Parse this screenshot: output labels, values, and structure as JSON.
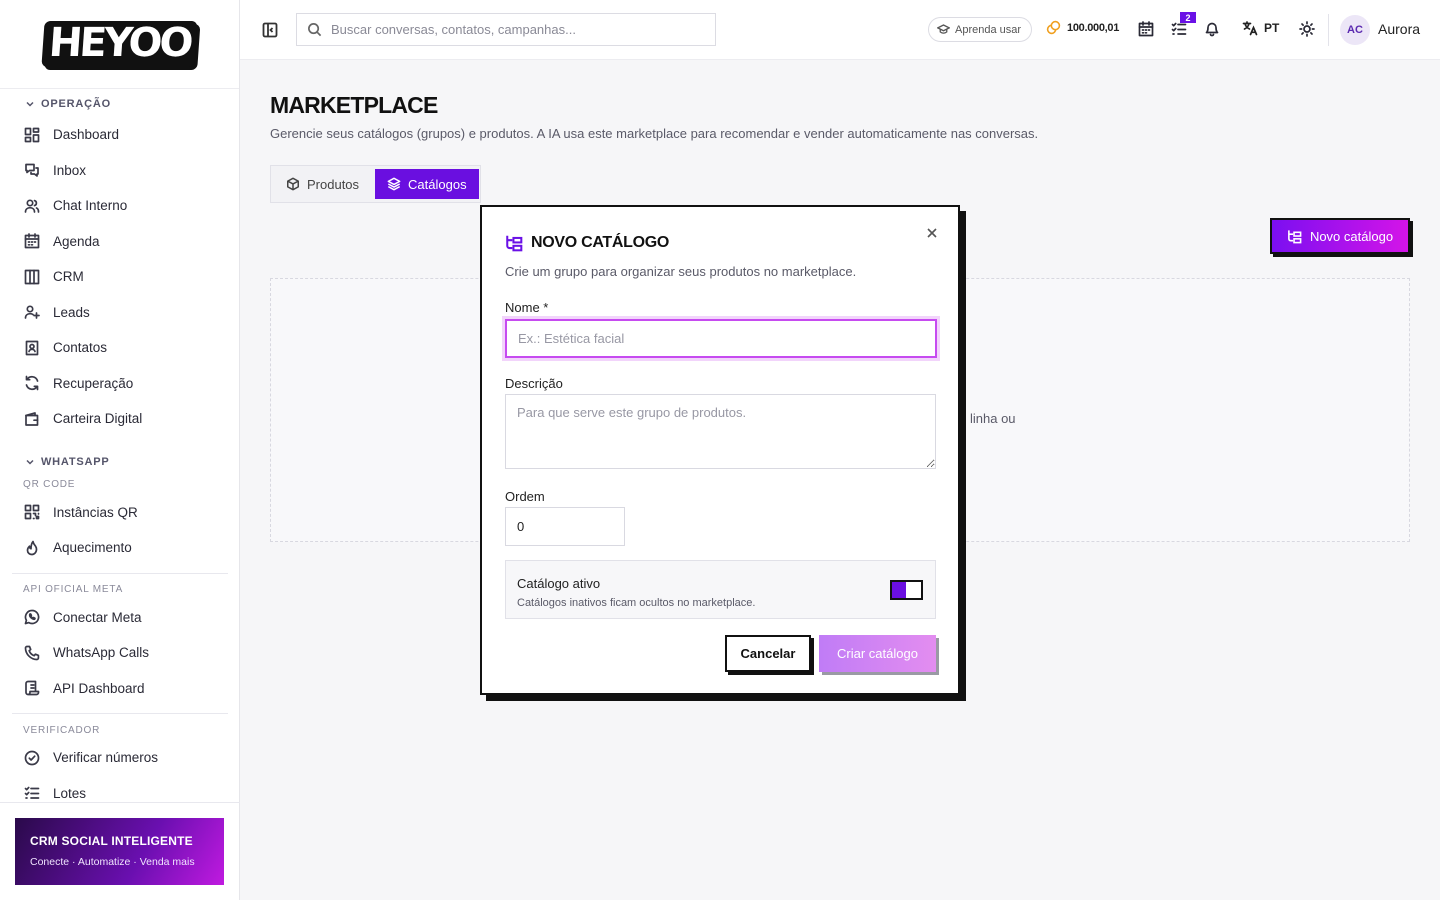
{
  "brand": {
    "logo_text": "HEYOO"
  },
  "sidebar": {
    "sections": [
      {
        "title": "OPERAÇÃO",
        "items": [
          "Dashboard",
          "Inbox",
          "Chat Interno",
          "Agenda",
          "CRM",
          "Leads",
          "Contatos",
          "Recuperação",
          "Carteira Digital"
        ]
      },
      {
        "title": "WHATSAPP",
        "subtitle": "QR CODE",
        "items": [
          "Instâncias QR",
          "Aquecimento"
        ]
      },
      {
        "subtitle": "API OFICIAL META",
        "items": [
          "Conectar Meta",
          "WhatsApp Calls",
          "API Dashboard"
        ]
      },
      {
        "subtitle": "VERIFICADOR",
        "items": [
          "Verificar números",
          "Lotes"
        ]
      }
    ],
    "promo": {
      "title": "CRM SOCIAL INTELIGENTE",
      "tagline": "Conecte · Automatize · Venda mais"
    }
  },
  "topbar": {
    "search_placeholder": "Buscar conversas, contatos, campanhas...",
    "learn_label": "Aprenda usar",
    "credits": "100.000,01",
    "tasks_badge": "2",
    "language": "PT",
    "avatar_initials": "AC",
    "username": "Aurora"
  },
  "page": {
    "title": "MARKETPLACE",
    "subtitle": "Gerencie seus catálogos (grupos) e produtos. A IA usa este marketplace para recomendar e vender automaticamente nas conversas.",
    "tabs": [
      {
        "label": "Produtos",
        "active": false
      },
      {
        "label": "Catálogos",
        "active": true
      }
    ],
    "new_catalog_label": "Novo catálogo",
    "empty_text_fragment": "linha ou"
  },
  "modal": {
    "title": "NOVO CATÁLOGO",
    "subtitle": "Crie um grupo para organizar seus produtos no marketplace.",
    "name_label": "Nome *",
    "name_placeholder": "Ex.: Estética facial",
    "description_label": "Descrição",
    "description_placeholder": "Para que serve este grupo de produtos.",
    "order_label": "Ordem",
    "order_value": "0",
    "active_title": "Catálogo ativo",
    "active_desc": "Catálogos inativos ficam ocultos no marketplace.",
    "active_on": true,
    "cancel_label": "Cancelar",
    "create_label": "Criar catálogo"
  },
  "colors": {
    "accent": "#6a0fe0",
    "accent_pink": "#d414e8",
    "focus": "#c64bf0"
  }
}
